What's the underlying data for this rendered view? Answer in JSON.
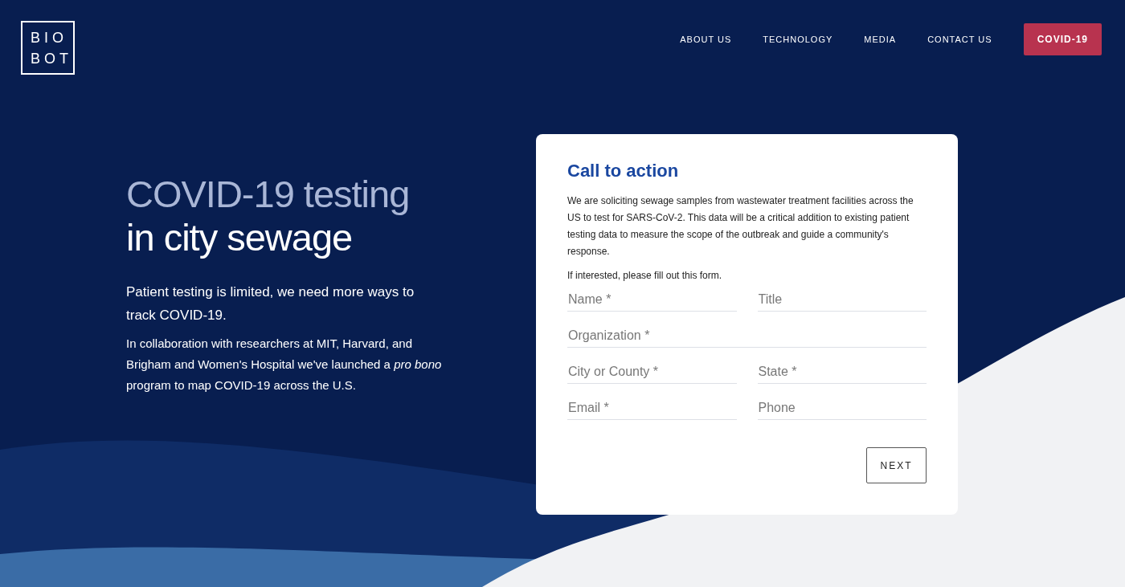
{
  "header": {
    "logo": [
      "BIO",
      "BOT"
    ],
    "nav": [
      {
        "label": "ABOUT US",
        "kind": "link"
      },
      {
        "label": "TECHNOLOGY",
        "kind": "link"
      },
      {
        "label": "MEDIA",
        "kind": "link"
      },
      {
        "label": "CONTACT US",
        "kind": "link"
      },
      {
        "label": "COVID-19",
        "kind": "button"
      }
    ]
  },
  "hero": {
    "headline": [
      "COVID-19 testing",
      "in city sewage"
    ],
    "lead": "Patient testing is limited, we need more ways to track COVID-19.",
    "body": "In collaboration with researchers at MIT, Harvard, and Brigham and Women's Hospital we've launched a *pro bono* program to map COVID-19 across the U.S."
  },
  "form": {
    "title": "Call to action",
    "intro": "We are soliciting sewage samples from wastewater treatment facilities across the US to test for SARS-CoV-2. This data will be a critical addition to existing patient testing data to measure the scope of the outbreak and guide a community's response.",
    "note": "If interested, please fill out this form.",
    "fields": [
      {
        "placeholder": "Name *",
        "kind": "half"
      },
      {
        "placeholder": "Title",
        "kind": "half"
      },
      {
        "placeholder": "Organization *",
        "kind": "full"
      },
      {
        "placeholder": "City or County *",
        "kind": "half"
      },
      {
        "placeholder": "State *",
        "kind": "half"
      },
      {
        "placeholder": "Email *",
        "kind": "half"
      },
      {
        "placeholder": "Phone",
        "kind": "half"
      }
    ],
    "button": "NEXT"
  }
}
